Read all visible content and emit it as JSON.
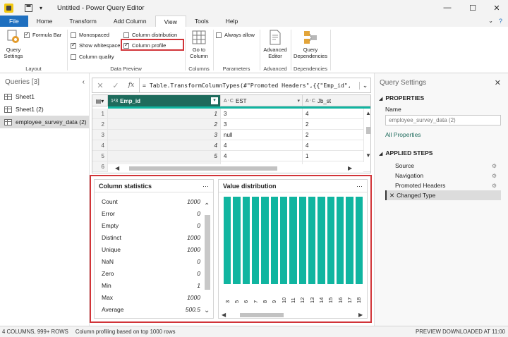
{
  "window": {
    "title": "Untitled - Power Query Editor",
    "minimize": "—",
    "maximize": "☐",
    "close": "✕"
  },
  "menu_tabs": [
    "File",
    "Home",
    "Transform",
    "Add Column",
    "View",
    "Tools",
    "Help"
  ],
  "active_tab": "View",
  "ribbon": {
    "layout": {
      "query_settings": "Query\nSettings",
      "formula_bar": "Formula Bar",
      "label": "Layout"
    },
    "data_preview": {
      "monospaced": "Monospaced",
      "show_whitespace": "Show whitespace",
      "column_quality": "Column quality",
      "column_distribution": "Column distribution",
      "column_profile": "Column profile",
      "label": "Data Preview"
    },
    "columns": {
      "go_to_column": "Go to\nColumn",
      "label": "Columns"
    },
    "parameters": {
      "always_allow": "Always allow",
      "label": "Parameters"
    },
    "advanced": {
      "advanced_editor": "Advanced\nEditor",
      "label": "Advanced"
    },
    "dependencies": {
      "query_dependencies": "Query\nDependencies",
      "label": "Dependencies"
    }
  },
  "queries": {
    "title": "Queries [3]",
    "items": [
      "Sheet1",
      "Sheet1 (2)",
      "employee_survey_data (2)"
    ],
    "selected": 2
  },
  "formula": {
    "text": "= Table.TransformColumnTypes(#\"Promoted Headers\",{{\"Emp_id\","
  },
  "grid": {
    "columns": [
      {
        "type": "1²3",
        "name": "Emp_id"
      },
      {
        "type": "A᛫C",
        "name": "EST"
      },
      {
        "type": "A᛫C",
        "name": "Jb_st"
      }
    ],
    "rows": [
      [
        "1",
        "1",
        "3",
        "4"
      ],
      [
        "2",
        "2",
        "3",
        "2"
      ],
      [
        "3",
        "3",
        "null",
        "2"
      ],
      [
        "4",
        "4",
        "4",
        "4"
      ],
      [
        "5",
        "5",
        "4",
        "1"
      ],
      [
        "6",
        "",
        "",
        ""
      ]
    ]
  },
  "column_stats": {
    "title": "Column statistics",
    "more": "···",
    "rows": [
      {
        "label": "Count",
        "value": "1000"
      },
      {
        "label": "Error",
        "value": "0"
      },
      {
        "label": "Empty",
        "value": "0"
      },
      {
        "label": "Distinct",
        "value": "1000"
      },
      {
        "label": "Unique",
        "value": "1000"
      },
      {
        "label": "NaN",
        "value": "0"
      },
      {
        "label": "Zero",
        "value": "0"
      },
      {
        "label": "Min",
        "value": "1"
      },
      {
        "label": "Max",
        "value": "1000"
      },
      {
        "label": "Average",
        "value": "500.5"
      }
    ]
  },
  "chart_data": {
    "type": "bar",
    "title": "Value distribution",
    "categories": [
      "3",
      "5",
      "6",
      "7",
      "8",
      "9",
      "10",
      "11",
      "12",
      "13",
      "14",
      "15",
      "16",
      "17",
      "18"
    ],
    "values": [
      1,
      1,
      1,
      1,
      1,
      1,
      1,
      1,
      1,
      1,
      1,
      1,
      1,
      1,
      1
    ],
    "ylim": [
      0,
      1
    ],
    "bar_color": "#10b5a0"
  },
  "settings": {
    "title": "Query Settings",
    "properties_label": "PROPERTIES",
    "name_label": "Name",
    "name_value": "employee_survey_data (2)",
    "all_properties": "All Properties",
    "applied_steps_label": "APPLIED STEPS",
    "steps": [
      "Source",
      "Navigation",
      "Promoted Headers",
      "Changed Type"
    ]
  },
  "status": {
    "left": "4 COLUMNS, 999+ ROWS",
    "middle": "Column profiling based on top 1000 rows",
    "right": "PREVIEW DOWNLOADED AT 11:00"
  },
  "colors": {
    "accent": "#1e6fbf",
    "highlight": "#d13438",
    "bar": "#10b5a0",
    "column_header": "#1e6b5c"
  }
}
